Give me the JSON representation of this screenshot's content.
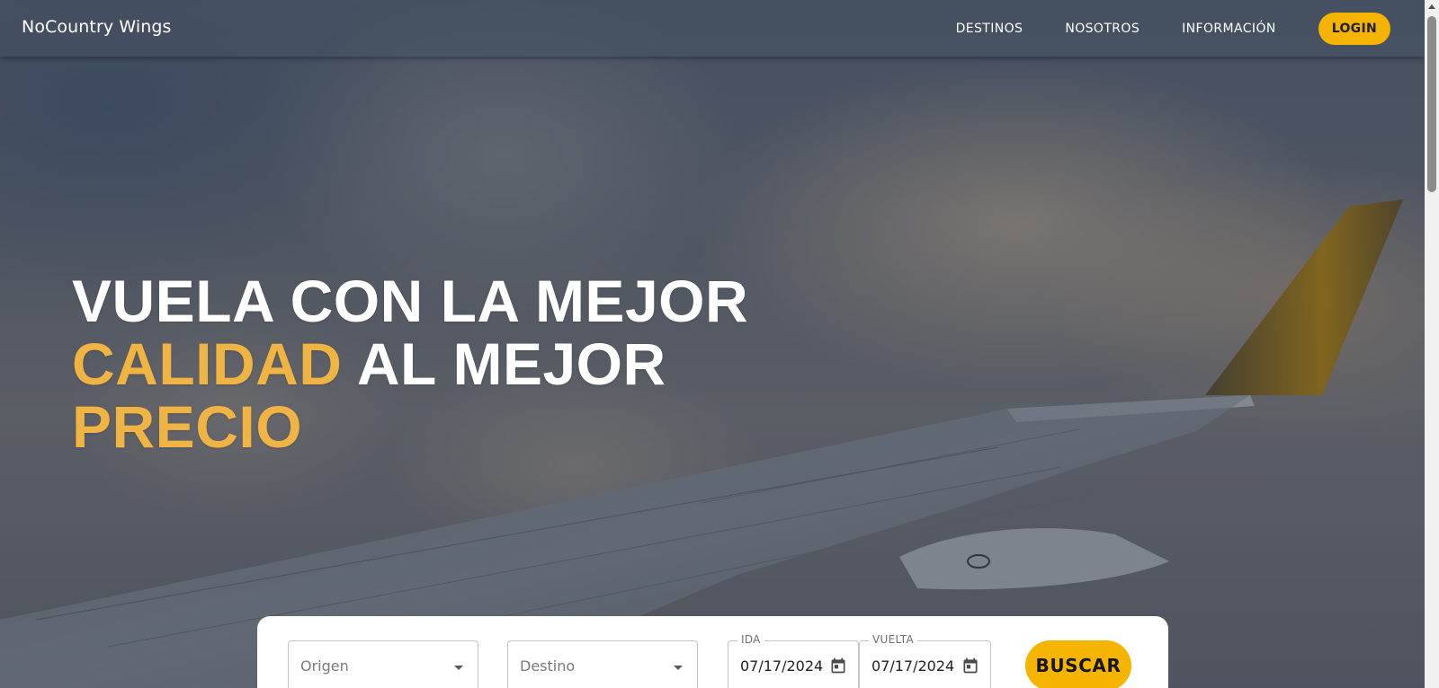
{
  "navbar": {
    "brand": "NoCountry Wings",
    "links": [
      "DESTINOS",
      "NOSOTROS",
      "INFORMACIÓN"
    ],
    "login_label": "LOGIN"
  },
  "hero": {
    "line1": "VUELA CON LA MEJOR",
    "line2_accent": "CALIDAD",
    "line2_rest": " AL MEJOR",
    "line3_accent": "PRECIO"
  },
  "search": {
    "origin_placeholder": "Origen",
    "destination_placeholder": "Destino",
    "ida_label": "IDA",
    "ida_value": "07/17/2024",
    "vuelta_label": "VUELTA",
    "vuelta_value": "07/17/2024",
    "search_label": "BUSCAR"
  },
  "colors": {
    "accent": "#f5b400",
    "headline_accent": "#f0b444"
  },
  "icons": {
    "calendar": "calendar-icon",
    "dropdown": "chevron-down-icon"
  }
}
